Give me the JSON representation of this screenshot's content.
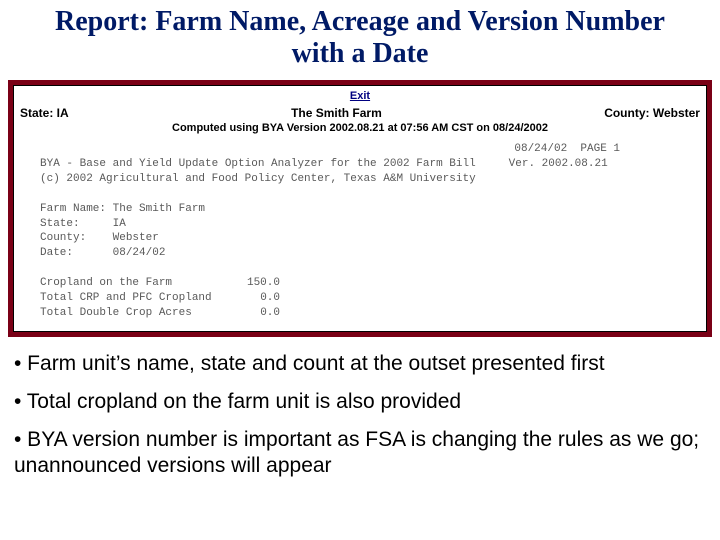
{
  "title": "Report:  Farm Name, Acreage and Version Number with a Date",
  "report": {
    "exit_label": "Exit",
    "state_label": "State: IA",
    "farm_name": "The Smith Farm",
    "county_label": "County: Webster",
    "computed": "Computed using BYA Version 2002.08.21 at 07:56 AM CST on 08/24/2002",
    "page_line": "08/24/02  PAGE 1",
    "bya_line1": "BYA - Base and Yield Update Option Analyzer for the 2002 Farm Bill     Ver. 2002.08.21",
    "bya_line2": "(c) 2002 Agricultural and Food Policy Center, Texas A&M University",
    "farm_block": {
      "farm_name_line": "Farm Name: The Smith Farm",
      "state_line": "State:     IA",
      "county_line": "County:    Webster",
      "date_line": "Date:      08/24/02"
    },
    "acreage": {
      "cropland_label": "Cropland on the Farm",
      "cropland_value": "150.0",
      "crp_label": "Total CRP and PFC Cropland",
      "crp_value": "0.0",
      "double_label": "Total Double Crop Acres",
      "double_value": "0.0"
    }
  },
  "bullets": {
    "b1": "• Farm unit’s name, state and count at the outset presented first",
    "b2": "• Total cropland on the farm unit is also provided",
    "b3": "• BYA version number is important as FSA is changing the rules as we go;  unannounced versions will appear"
  }
}
